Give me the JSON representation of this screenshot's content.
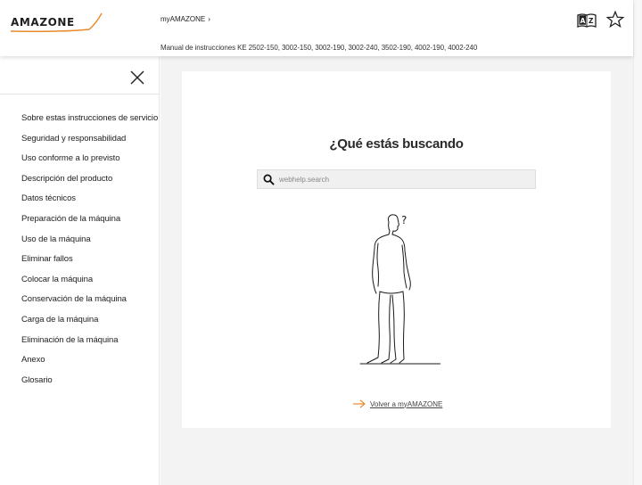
{
  "header": {
    "logo_text": "AMAZONE",
    "breadcrumb": "myAMAZONE",
    "breadcrumb_sep": "›",
    "doc_title": "Manual de instrucciones KE 2502-150, 3002-150, 3002-190, 3002-240, 3502-190, 4002-190, 4002-240",
    "icons": [
      "dictionary-icon",
      "star-icon"
    ]
  },
  "sidebar": {
    "items": [
      {
        "label": "Sobre estas instrucciones de servicio"
      },
      {
        "label": "Seguridad y responsabilidad"
      },
      {
        "label": "Uso conforme a lo previsto"
      },
      {
        "label": "Descripción del producto"
      },
      {
        "label": "Datos técnicos"
      },
      {
        "label": "Preparación de la máquina"
      },
      {
        "label": "Uso de la máquina"
      },
      {
        "label": "Eliminar fallos"
      },
      {
        "label": "Colocar la máquina"
      },
      {
        "label": "Conservación de la máquina"
      },
      {
        "label": "Carga de la máquina"
      },
      {
        "label": "Eliminación de la máquina"
      },
      {
        "label": "Anexo"
      },
      {
        "label": "Glosario"
      }
    ]
  },
  "main": {
    "heading": "¿Qué estás buscando",
    "search": {
      "placeholder": "webhelp.search",
      "value": ""
    },
    "illustration_text": "?",
    "back_link": "Volver a myAMAZONE"
  },
  "colors": {
    "accent": "#e8892b",
    "background": "#f3f3f3",
    "card": "#ffffff",
    "text": "#222222"
  }
}
